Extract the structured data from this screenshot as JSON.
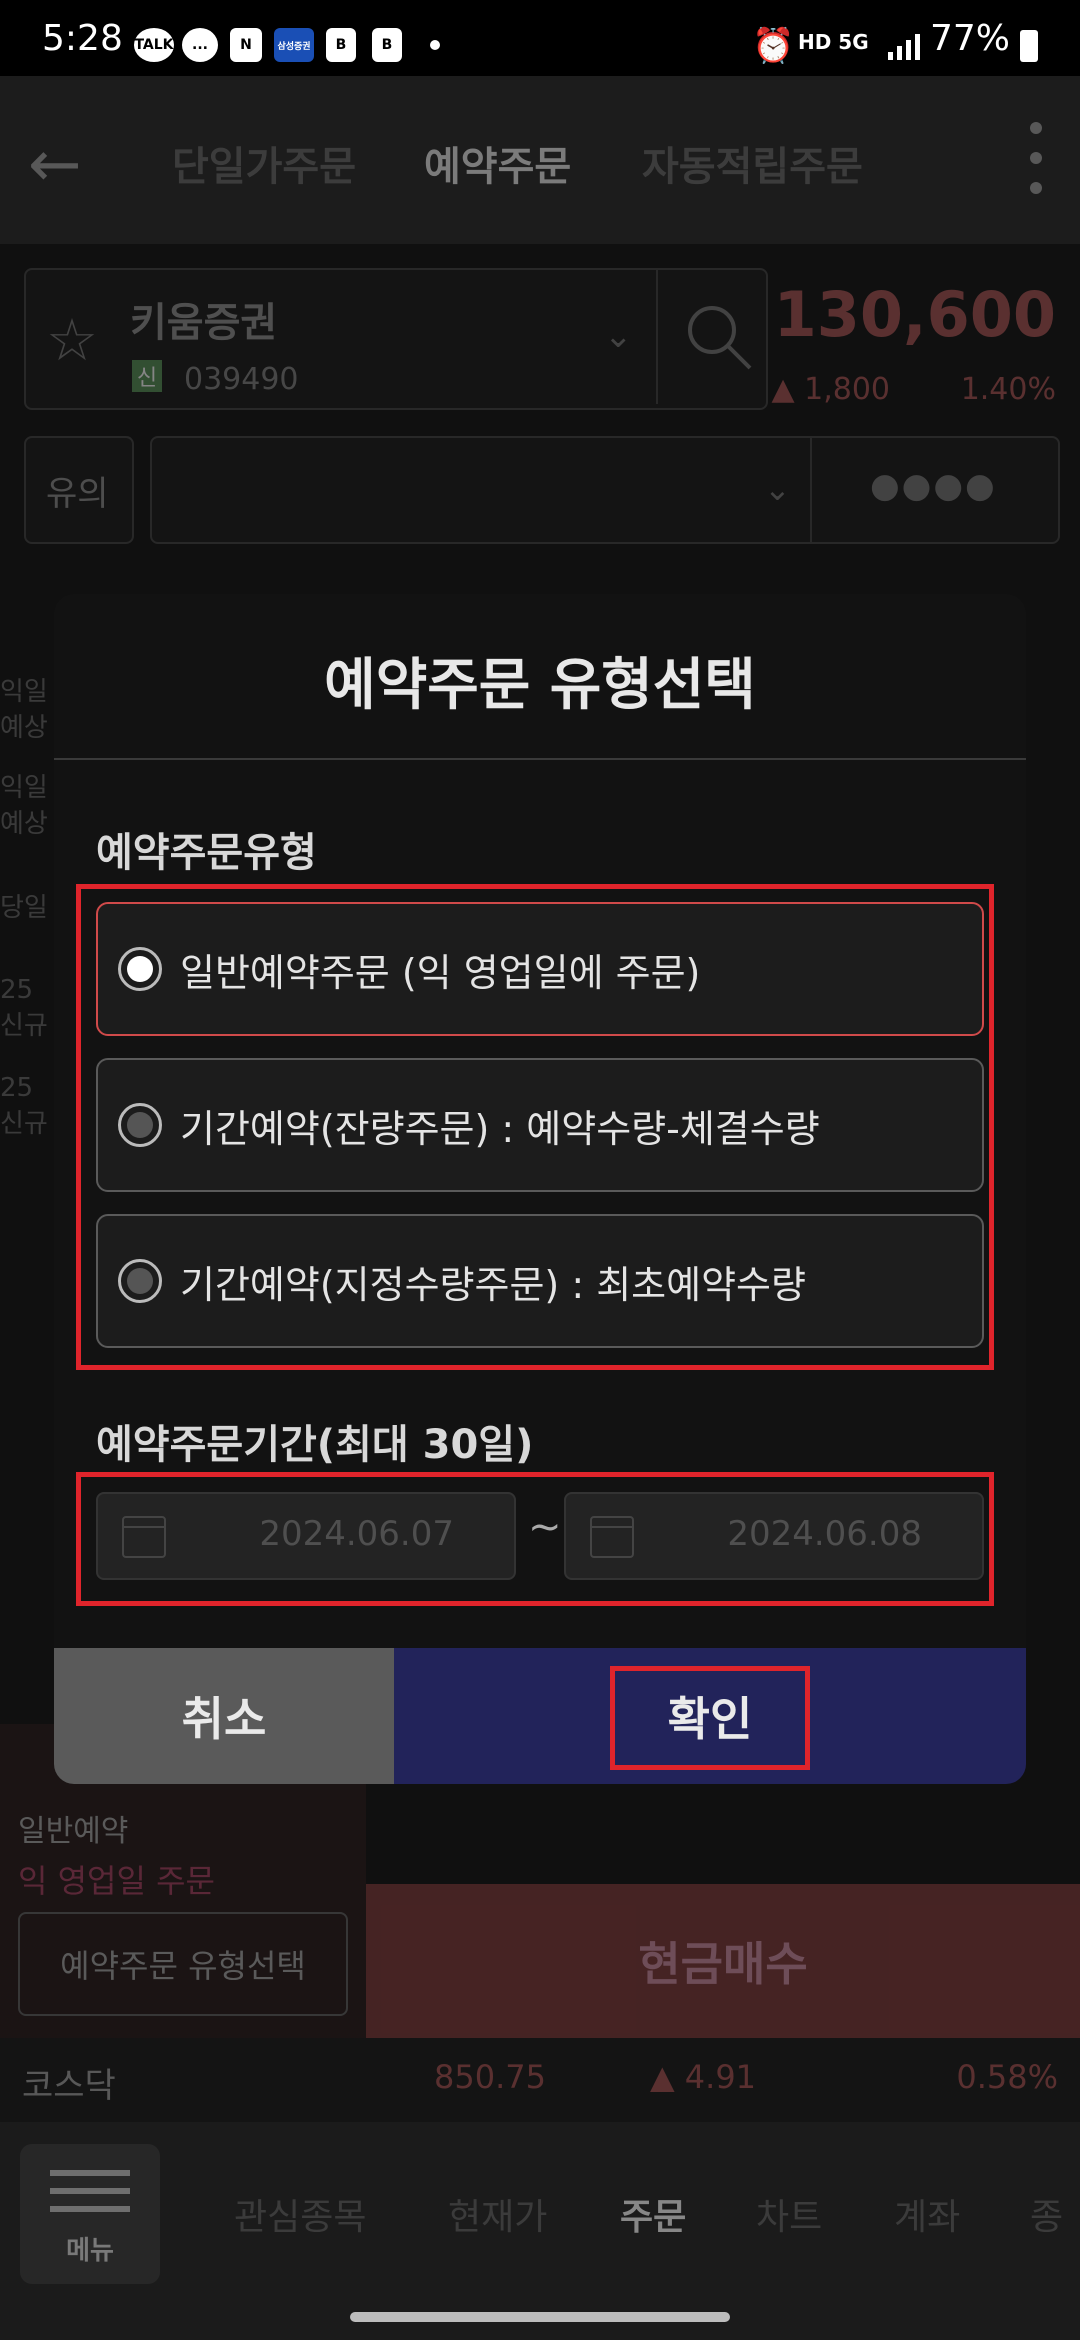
{
  "status": {
    "time": "5:28",
    "notifications": [
      "TALK",
      "...",
      "N",
      "삼성증권",
      "B",
      "B"
    ],
    "network": "HD 5G",
    "battery": "77%"
  },
  "header": {
    "tabs": [
      {
        "label": "단일가주문",
        "active": false
      },
      {
        "label": "예약주문",
        "active": true
      },
      {
        "label": "자동적립주문",
        "active": false
      }
    ]
  },
  "stock": {
    "name": "키움증권",
    "badge": "신",
    "code": "039490",
    "price": "130,600",
    "change": "▲ 1,800",
    "change_pct": "1.40%",
    "notice_label": "유의",
    "password_mask": "●●●●"
  },
  "background_list": [
    "익일 예상",
    "익일 예상",
    "당일",
    "25 신규",
    "25 신규"
  ],
  "modal": {
    "title": "예약주문 유형선택",
    "type_section_label": "예약주문유형",
    "options": [
      {
        "label": "일반예약주문 (익 영업일에 주문)",
        "selected": true
      },
      {
        "label": "기간예약(잔량주문) : 예약수량-체결수량",
        "selected": false
      },
      {
        "label": "기간예약(지정수량주문) : 최초예약수량",
        "selected": false
      }
    ],
    "period_section_label": "예약주문기간(최대 30일)",
    "start_date": "2024.06.07",
    "separator": "~",
    "end_date": "2024.06.08",
    "cancel_label": "취소",
    "confirm_label": "확인"
  },
  "lower": {
    "order_kind": "일반예약",
    "order_note": "익 영업일 주문",
    "type_select_button": "예약주문 유형선택",
    "buy_button": "현금매수"
  },
  "index": {
    "name": "코스닥",
    "value": "850.75",
    "change": "▲ 4.91",
    "change_pct": "0.58%"
  },
  "bottom_nav": {
    "menu_label": "메뉴",
    "items": [
      {
        "label": "관심종목",
        "active": false
      },
      {
        "label": "현재가",
        "active": false
      },
      {
        "label": "주문",
        "active": true
      },
      {
        "label": "차트",
        "active": false
      },
      {
        "label": "계좌",
        "active": false
      },
      {
        "label": "종",
        "active": false
      }
    ]
  },
  "colors": {
    "highlight_red": "#e0242b",
    "confirm_bg": "#22235a",
    "price_red": "#8a4a4a"
  }
}
